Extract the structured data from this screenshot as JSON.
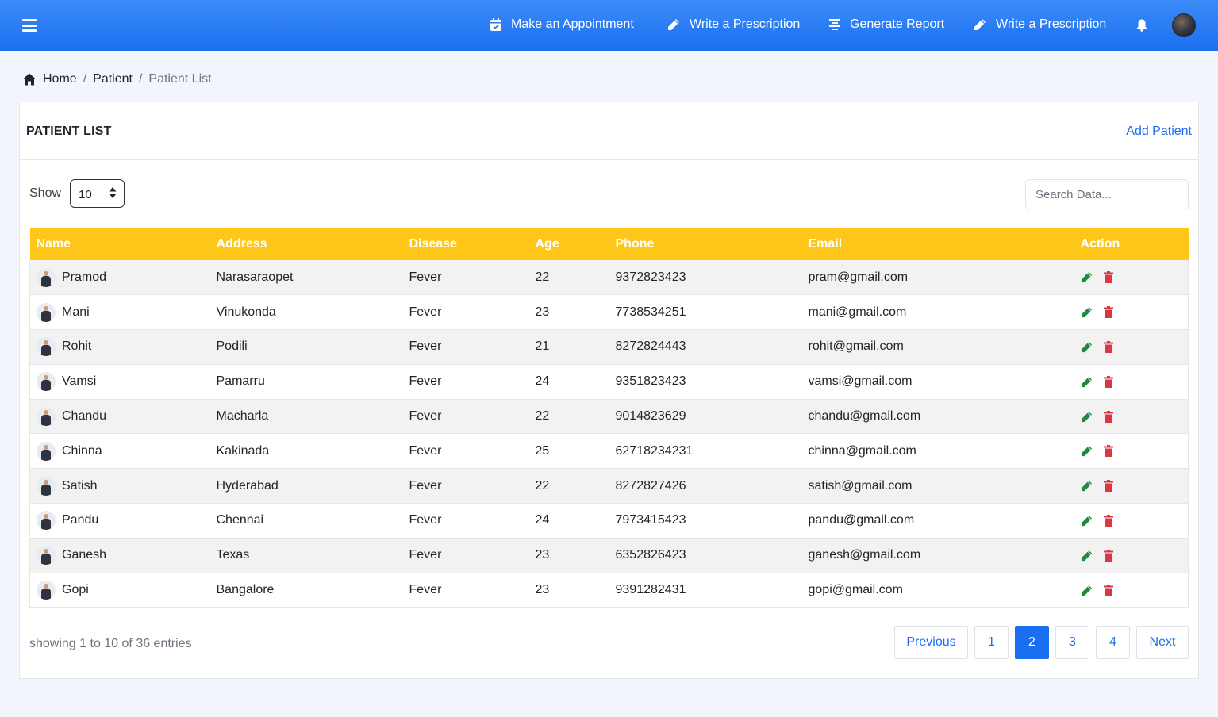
{
  "header": {
    "nav": [
      {
        "label": "Make an Appointment",
        "icon": "calendar-check-icon"
      },
      {
        "label": "Write a Prescription",
        "icon": "pencil-icon"
      },
      {
        "label": "Generate Report",
        "icon": "align-center-icon"
      },
      {
        "label": "Write a Prescription",
        "icon": "pencil-icon"
      }
    ]
  },
  "breadcrumb": {
    "home": "Home",
    "section": "Patient",
    "current": "Patient List",
    "sep": "/"
  },
  "card": {
    "title": "PATIENT LIST",
    "add_label": "Add Patient"
  },
  "controls": {
    "show_label": "Show",
    "page_size": "10",
    "search_placeholder": "Search Data..."
  },
  "table": {
    "columns": [
      "Name",
      "Address",
      "Disease",
      "Age",
      "Phone",
      "Email",
      "Action"
    ],
    "rows": [
      {
        "name": "Pramod",
        "address": "Narasaraopet",
        "disease": "Fever",
        "age": "22",
        "phone": "9372823423",
        "email": "pram@gmail.com"
      },
      {
        "name": "Mani",
        "address": "Vinukonda",
        "disease": "Fever",
        "age": "23",
        "phone": "7738534251",
        "email": "mani@gmail.com"
      },
      {
        "name": "Rohit",
        "address": "Podili",
        "disease": "Fever",
        "age": "21",
        "phone": "8272824443",
        "email": "rohit@gmail.com"
      },
      {
        "name": "Vamsi",
        "address": "Pamarru",
        "disease": "Fever",
        "age": "24",
        "phone": "9351823423",
        "email": "vamsi@gmail.com"
      },
      {
        "name": "Chandu",
        "address": "Macharla",
        "disease": "Fever",
        "age": "22",
        "phone": "9014823629",
        "email": "chandu@gmail.com"
      },
      {
        "name": "Chinna",
        "address": "Kakinada",
        "disease": "Fever",
        "age": "25",
        "phone": "62718234231",
        "email": "chinna@gmail.com"
      },
      {
        "name": "Satish",
        "address": "Hyderabad",
        "disease": "Fever",
        "age": "22",
        "phone": "8272827426",
        "email": "satish@gmail.com"
      },
      {
        "name": "Pandu",
        "address": "Chennai",
        "disease": "Fever",
        "age": "24",
        "phone": "7973415423",
        "email": "pandu@gmail.com"
      },
      {
        "name": "Ganesh",
        "address": "Texas",
        "disease": "Fever",
        "age": "23",
        "phone": "6352826423",
        "email": "ganesh@gmail.com"
      },
      {
        "name": "Gopi",
        "address": "Bangalore",
        "disease": "Fever",
        "age": "23",
        "phone": "9391282431",
        "email": "gopi@gmail.com"
      }
    ]
  },
  "footer": {
    "entries_text": "showing 1 to 10 of 36 entries",
    "pagination": {
      "previous": "Previous",
      "pages": [
        "1",
        "2",
        "3",
        "4"
      ],
      "active": "2",
      "next": "Next"
    }
  },
  "colors": {
    "topbar": "#1a6ff0",
    "table_header": "#ffc61a",
    "edit": "#1f8a3d",
    "delete": "#dc3545",
    "link": "#1a6ff0"
  }
}
